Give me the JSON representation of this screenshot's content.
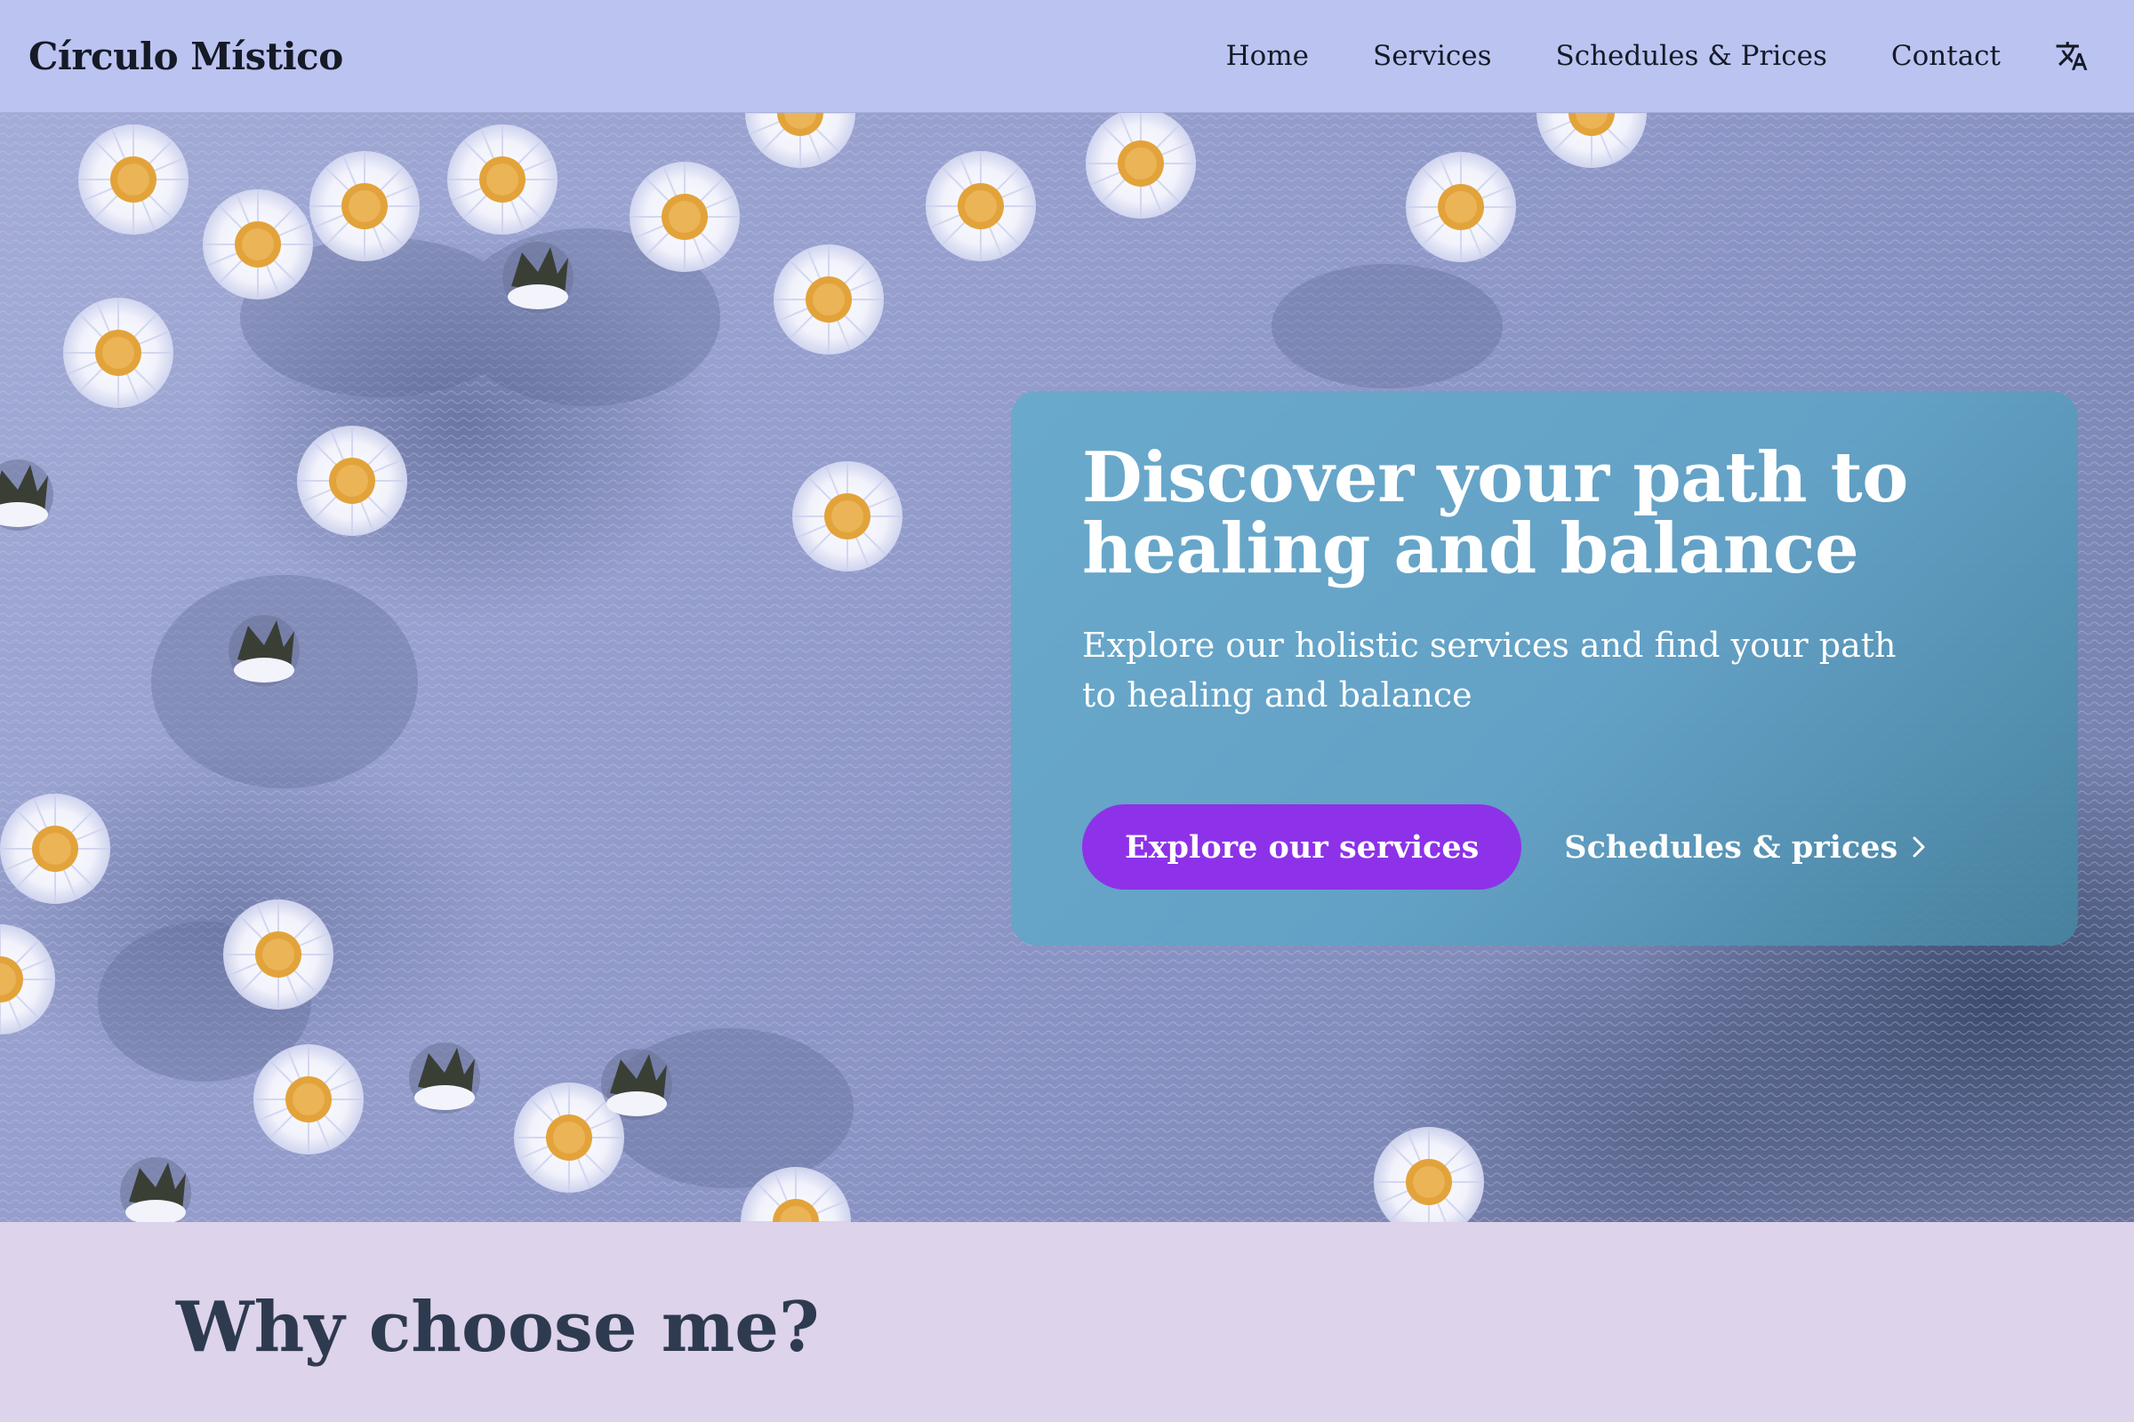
{
  "nav": {
    "brand": "Círculo Místico",
    "links": [
      "Home",
      "Services",
      "Schedules & Prices",
      "Contact"
    ],
    "language_icon": "translate-icon"
  },
  "hero": {
    "title": "Discover your path to healing and balance",
    "subtitle": "Explore our holistic services and find your path to healing and balance",
    "primary_cta": "Explore our services",
    "secondary_cta": "Schedules & prices",
    "secondary_icon": "chevron-right-icon",
    "background": "daisies-on-towel-image"
  },
  "why": {
    "title": "Why choose me?"
  },
  "colors": {
    "nav_bg": "#bbc3f1",
    "card_bg": "#67aacb",
    "primary_button": "#8d32e8",
    "section_bg": "#ddd3ea",
    "heading": "#2e3a4f"
  }
}
